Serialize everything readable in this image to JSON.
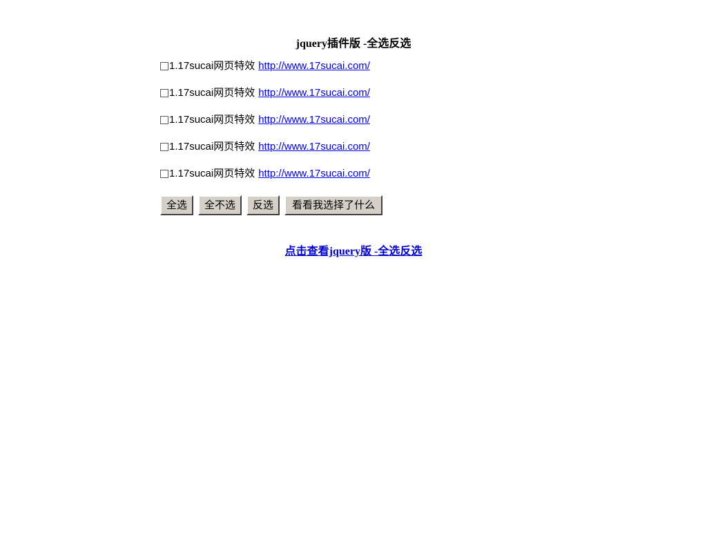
{
  "page": {
    "title": "jquery插件版 -全选反选",
    "background_color": "#ffffff",
    "link_color": "#0000ee",
    "footer_link_color": "#0000cc",
    "button_face_color": "#d4d0c8"
  },
  "checkbox_list": {
    "rows": [
      {
        "label": "1.17sucai网页特效",
        "link_text": "http://www.17sucai.com/",
        "checked": false
      },
      {
        "label": "1.17sucai网页特效",
        "link_text": "http://www.17sucai.com/",
        "checked": false
      },
      {
        "label": "1.17sucai网页特效",
        "link_text": "http://www.17sucai.com/",
        "checked": false
      },
      {
        "label": "1.17sucai网页特效",
        "link_text": "http://www.17sucai.com/",
        "checked": false
      },
      {
        "label": "1.17sucai网页特效",
        "link_text": "http://www.17sucai.com/",
        "checked": false
      }
    ]
  },
  "buttons": {
    "select_all": "全选",
    "select_none": "全不选",
    "invert": "反选",
    "show_selection": "看看我选择了什么"
  },
  "footer": {
    "link_text": "点击查看jquery版 -全选反选"
  }
}
